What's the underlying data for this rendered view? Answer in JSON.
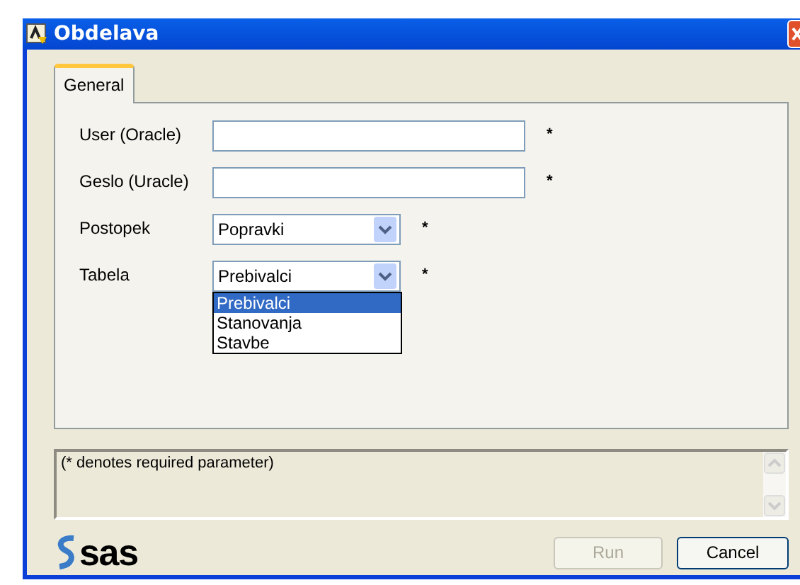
{
  "window": {
    "title": "Obdelava"
  },
  "tabs": [
    {
      "label": "General",
      "selected": true
    }
  ],
  "fields": [
    {
      "kind": "text",
      "label": "User (Oracle)",
      "required": "*"
    },
    {
      "kind": "text",
      "label": "Geslo (Uracle)",
      "required": "*"
    },
    {
      "kind": "combo",
      "label": "Postopek",
      "value": "Popravki",
      "required": "*"
    },
    {
      "kind": "combo",
      "label": "Tabela",
      "value": "Prebivalci",
      "required": "*",
      "expanded": true,
      "options": [
        {
          "label": "Prebivalci",
          "selected": true
        },
        {
          "label": "Stanovanja",
          "selected": false
        },
        {
          "label": "Stavbe",
          "selected": false
        }
      ]
    }
  ],
  "message": "(* denotes required parameter)",
  "logo": "sas",
  "buttons": [
    {
      "label": "Run",
      "disabled": true
    },
    {
      "label": "Cancel",
      "disabled": false
    }
  ]
}
